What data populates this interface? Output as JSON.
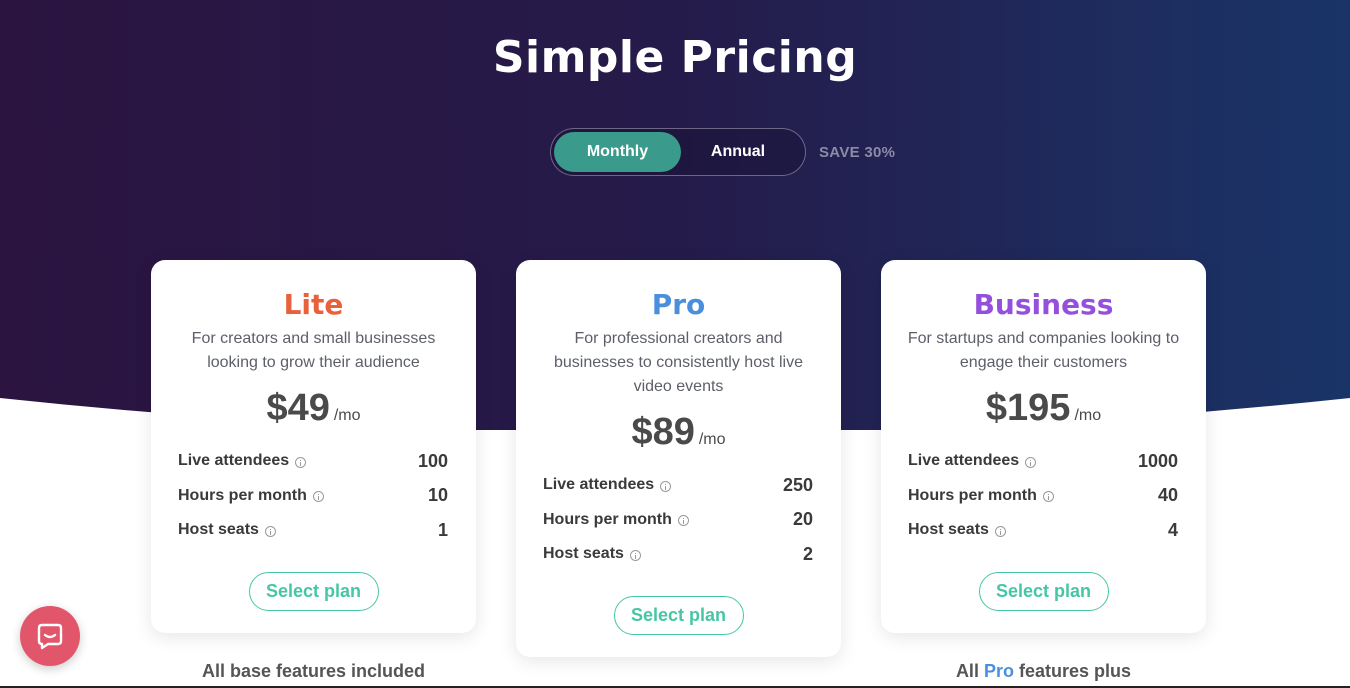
{
  "header": {
    "title": "Simple Pricing",
    "toggle": {
      "monthly_label": "Monthly",
      "annual_label": "Annual",
      "selected": "Monthly"
    },
    "save_badge": "SAVE 30%"
  },
  "colors": {
    "lite": "#e8603c",
    "pro": "#4a8fdc",
    "business": "#9450dc",
    "accent_teal": "#46c6a6",
    "toggle_active": "#3a9b8c",
    "chat": "#e2566b"
  },
  "plans": [
    {
      "name": "Lite",
      "description": "For creators and small businesses looking to grow their audience",
      "price": "$49",
      "per": "/mo",
      "features": [
        {
          "label": "Live attendees",
          "value": "100"
        },
        {
          "label": "Hours per month",
          "value": "10"
        },
        {
          "label": "Host seats",
          "value": "1"
        }
      ],
      "button_label": "Select plan"
    },
    {
      "name": "Pro",
      "description": "For professional creators and businesses to consistently host live video events",
      "price": "$89",
      "per": "/mo",
      "features": [
        {
          "label": "Live attendees",
          "value": "250"
        },
        {
          "label": "Hours per month",
          "value": "20"
        },
        {
          "label": "Host seats",
          "value": "2"
        }
      ],
      "button_label": "Select plan"
    },
    {
      "name": "Business",
      "description": "For startups and companies looking to engage their customers",
      "price": "$195",
      "per": "/mo",
      "features": [
        {
          "label": "Live attendees",
          "value": "1000"
        },
        {
          "label": "Hours per month",
          "value": "40"
        },
        {
          "label": "Host seats",
          "value": "4"
        }
      ],
      "button_label": "Select plan"
    }
  ],
  "footer_notes": {
    "lite": "All base features included",
    "business_prefix": "All",
    "business_accent": "Pro",
    "business_suffix": "features plus"
  },
  "chat_launcher": {
    "icon": "chat-bubble-icon"
  }
}
